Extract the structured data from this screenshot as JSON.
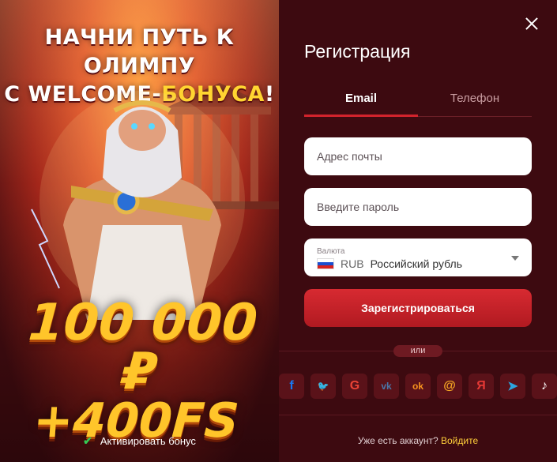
{
  "promo": {
    "headline_line1": "НАЧНИ ПУТЬ К ОЛИМПУ",
    "headline_prefix": "С WELCOME-",
    "headline_accent": "БОНУСА",
    "headline_suffix": "!",
    "amount_line1": "100 000 ₽",
    "amount_line2": "+400FS",
    "activate_label": "Активировать бонус"
  },
  "form": {
    "title": "Регистрация",
    "tabs": [
      {
        "label": "Email",
        "active": true
      },
      {
        "label": "Телефон",
        "active": false
      }
    ],
    "email_placeholder": "Адрес почты",
    "password_placeholder": "Введите пароль",
    "currency": {
      "label": "Валюта",
      "code": "RUB",
      "name": "Российский рубль"
    },
    "submit_label": "Зарегистрироваться",
    "or_label": "или",
    "socials": [
      {
        "name": "facebook",
        "glyph": "f",
        "color": "#1877f2"
      },
      {
        "name": "twitter",
        "glyph": "🐦",
        "color": "#1da1f2"
      },
      {
        "name": "google",
        "glyph": "G",
        "color": "#ea4335"
      },
      {
        "name": "vk",
        "glyph": "vk",
        "color": "#4a76a8"
      },
      {
        "name": "odnoklassniki",
        "glyph": "ok",
        "color": "#f7931e"
      },
      {
        "name": "mailru",
        "glyph": "@",
        "color": "#f5a623"
      },
      {
        "name": "yandex",
        "glyph": "Я",
        "color": "#e53935"
      },
      {
        "name": "telegram",
        "glyph": "➤",
        "color": "#2ca5e0"
      },
      {
        "name": "tiktok",
        "glyph": "♪",
        "color": "#ffffff"
      }
    ],
    "login_prompt": "Уже есть аккаунт?",
    "login_link": "Войдите"
  }
}
